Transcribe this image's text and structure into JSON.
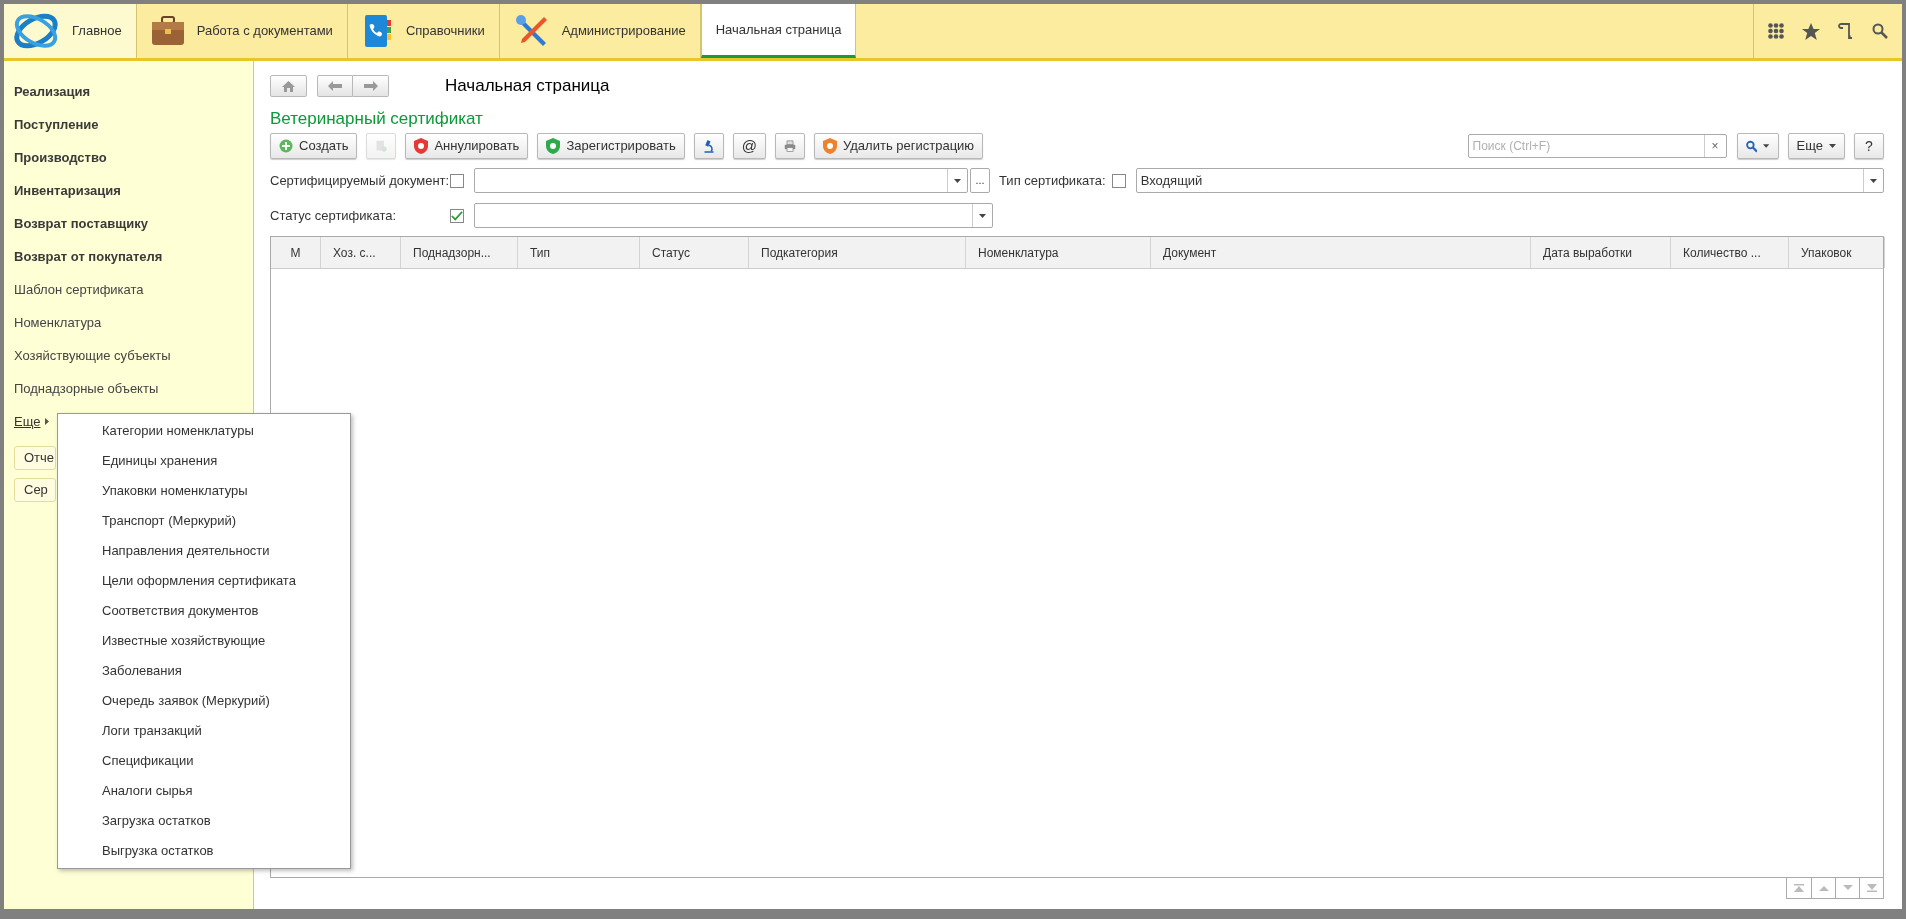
{
  "top_nav": {
    "sections": [
      {
        "label": "Главное",
        "selected": false
      },
      {
        "label": "Работа с документами",
        "selected": false
      },
      {
        "label": "Справочники",
        "selected": false
      },
      {
        "label": "Администрирование",
        "selected": false
      },
      {
        "label": "Начальная страница",
        "selected": true
      }
    ]
  },
  "sidebar": {
    "items": [
      {
        "label": "Реализация",
        "bold": true
      },
      {
        "label": "Поступление",
        "bold": true
      },
      {
        "label": "Производство",
        "bold": true
      },
      {
        "label": "Инвентаризация",
        "bold": true
      },
      {
        "label": "Возврат поставщику",
        "bold": true
      },
      {
        "label": "Возврат от покупателя",
        "bold": true
      },
      {
        "label": "Шаблон сертификата",
        "bold": false
      },
      {
        "label": "Номенклатура",
        "bold": false
      },
      {
        "label": "Хозяйствующие субъекты",
        "bold": false
      },
      {
        "label": "Поднадзорные объекты",
        "bold": false
      }
    ],
    "more_link": "Еще",
    "buttons": [
      "Отче",
      "Сер"
    ]
  },
  "page_title": "Начальная страница",
  "form": {
    "title": "Ветеринарный сертификат",
    "toolbar": [
      {
        "kind": "button",
        "label": "Создать",
        "disabled": false
      },
      {
        "kind": "icon_button",
        "disabled": true
      },
      {
        "kind": "button",
        "label": "Аннулировать",
        "disabled": false
      },
      {
        "kind": "button",
        "label": "Зарегистрировать",
        "disabled": false
      },
      {
        "kind": "icon_button",
        "disabled": false
      },
      {
        "kind": "button",
        "label": "@",
        "disabled": false
      },
      {
        "kind": "icon_button",
        "disabled": false
      },
      {
        "kind": "button",
        "label": "Удалить регистрацию",
        "disabled": false
      }
    ],
    "search": {
      "placeholder": "Поиск (Ctrl+F)",
      "clear": "×"
    },
    "more_button": "Еще",
    "help_button": "?",
    "filters": [
      {
        "label": "Сертифицируемый документ:",
        "checked": false,
        "ellipsis": "..."
      },
      {
        "label": "Тип сертификата:",
        "checked": false,
        "value": "Входящий"
      },
      {
        "label": "Статус сертификата:",
        "checked": true
      }
    ],
    "table": {
      "columns": [
        "М",
        "Хоз. с...",
        "Поднадзорн...",
        "Тип",
        "Статус",
        "Подкатегория",
        "Номенклатура",
        "Документ",
        "Дата выработки",
        "Количество ...",
        "Упаковок"
      ]
    }
  },
  "popup_menu": {
    "items": [
      "Категории номенклатуры",
      "Единицы хранения",
      "Упаковки номенклатуры",
      "Транспорт (Меркурий)",
      "Направления деятельности",
      "Цели оформления сертификата",
      "Соответствия документов",
      "Известные хозяйствующие",
      "Заболевания",
      "Очередь заявок (Меркурий)",
      "Логи транзакций",
      "Спецификации",
      "Аналоги сырья",
      "Загрузка остатков",
      "Выгрузка остатков"
    ]
  }
}
